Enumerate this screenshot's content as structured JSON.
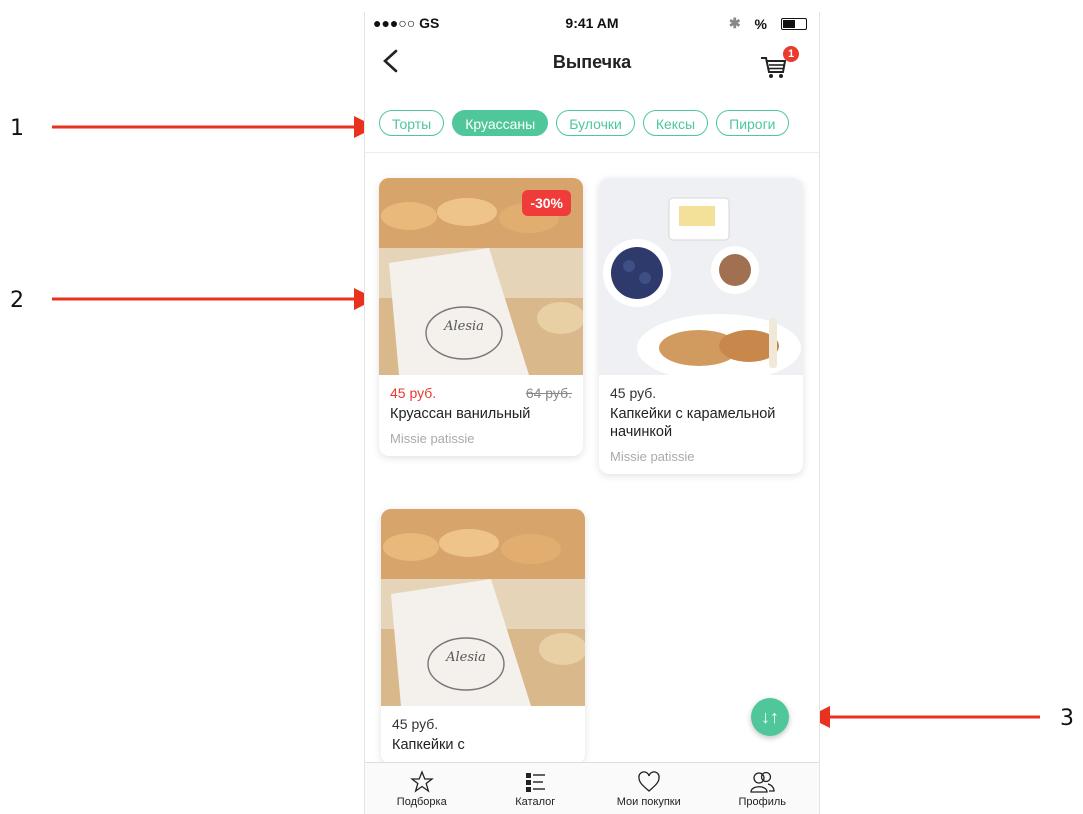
{
  "callouts": [
    "1",
    "2",
    "3"
  ],
  "status": {
    "signal": "●●●○○ GS",
    "time": "9:41 AM",
    "battery_pct": "%"
  },
  "nav": {
    "title": "Выпечка",
    "cart_count": "1"
  },
  "categories": [
    "Торты",
    "Круассаны",
    "Булочки",
    "Кексы",
    "Пироги"
  ],
  "active_category": "Круассаны",
  "products": [
    {
      "price": "45 руб.",
      "old_price": "64 руб.",
      "name": "Круассан ванильный",
      "seller": "Missie patissie",
      "discount": "-30%"
    },
    {
      "price": "45 руб.",
      "name": "Капкейки с карамельной начинкой",
      "seller": "Missie patissie"
    },
    {
      "price": "45 руб.",
      "name": "Капкейки с",
      "seller": ""
    }
  ],
  "tabs": [
    "Подборка",
    "Каталог",
    "Мои покупки",
    "Профиль"
  ],
  "fab_icon": "sort-icon",
  "colors": {
    "accent": "#4fc79a",
    "sale": "#ea3a2e",
    "arrow": "#e8321f"
  }
}
